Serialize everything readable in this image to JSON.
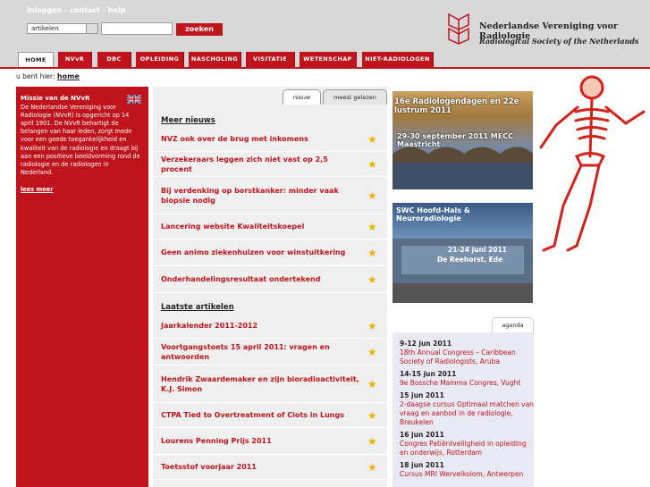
{
  "header": {
    "links": "inloggen - contact - help",
    "search_select": "artikelen",
    "search_button": "zoeken",
    "org_name": "Nederlandse Vereniging voor Radiologie",
    "org_sub": "Radiological Society of the Netherlands"
  },
  "nav": [
    "HOME",
    "NVvR",
    "DBC",
    "OPLEIDING",
    "NASCHOLING",
    "VISITATIE",
    "WETENSCHAP",
    "NIET-RADIOLOGEN"
  ],
  "breadcrumb": {
    "prefix": "u bent hier:",
    "current": "home"
  },
  "mission": {
    "title": "Missie van de NVvR",
    "text": "De Nederlandse Vereniging voor Radiologie (NVvR) is opgericht op 14 april 1901. De NVvR behartigt de belangen van haar leden, zorgt mede voor een goede toegankelijkheid en kwaliteit van de radiologie en draagt bij aan een positieve beeldvorming rond de radiologie en de radiologen in Nederland.",
    "more": "lees meer"
  },
  "tabs": {
    "new": "nieuw",
    "most_read": "meest gelezen"
  },
  "news": {
    "heading": "Meer nieuws",
    "items": [
      "NVZ ook over de brug met inkomens",
      "Verzekeraars leggen zich niet vast op 2,5 procent",
      "Bij verdenking op borstkanker: minder vaak biopsie nodig",
      "Lancering website Kwaliteitskoepel",
      "Geen animo ziekenhuizen voor winstuitkering",
      "Onderhandelingsresultaat ondertekend"
    ]
  },
  "articles": {
    "heading": "Laatste artikelen",
    "items": [
      "Jaarkalender 2011-2012",
      "Voortgangstoets 15 april 2011: vragen en antwoorden",
      "Hendrik Zwaardemaker en zijn bioradioactiviteit, K.J. Simon",
      "CTPA Tied to Overtreatment of Clots in Lungs",
      "Lourens Penning Prijs 2011",
      "Toetsstof voorjaar 2011"
    ]
  },
  "ads": {
    "ad1_title": "16e Radiologendagen en 22e lustrum 2011",
    "ad1_date": "29-30 september 2011 MECC Maastricht",
    "ad2_title": "SWC Hoofd-Hals & Neuroradiologie",
    "ad2_date": "21-24 juni 2011",
    "ad2_place": "De Reehorst, Ede"
  },
  "agenda": {
    "tab": "agenda",
    "events": [
      {
        "date": "9-12 jun 2011",
        "title": "18th Annual Congress – Caribbean Society of Radiologists, Aruba"
      },
      {
        "date": "14-15 jun 2011",
        "title": "9e Bossche Mamma Congres, Vught"
      },
      {
        "date": "15 jun 2011",
        "title": "2-daagse cursus Optimaal matchen van vraag en aanbod in de radiologie, Breukelen"
      },
      {
        "date": "16 jun 2011",
        "title": "Congres Patiëntveiligheid in opleiding en onderwijs, Rotterdam"
      },
      {
        "date": "18 jun 2011",
        "title": "Cursus MRI Wervelkolom, Antwerpen"
      }
    ]
  },
  "colors": {
    "brand_red": "#c0141c",
    "header_gray": "#d8d8d8",
    "star": "#e8b400"
  }
}
